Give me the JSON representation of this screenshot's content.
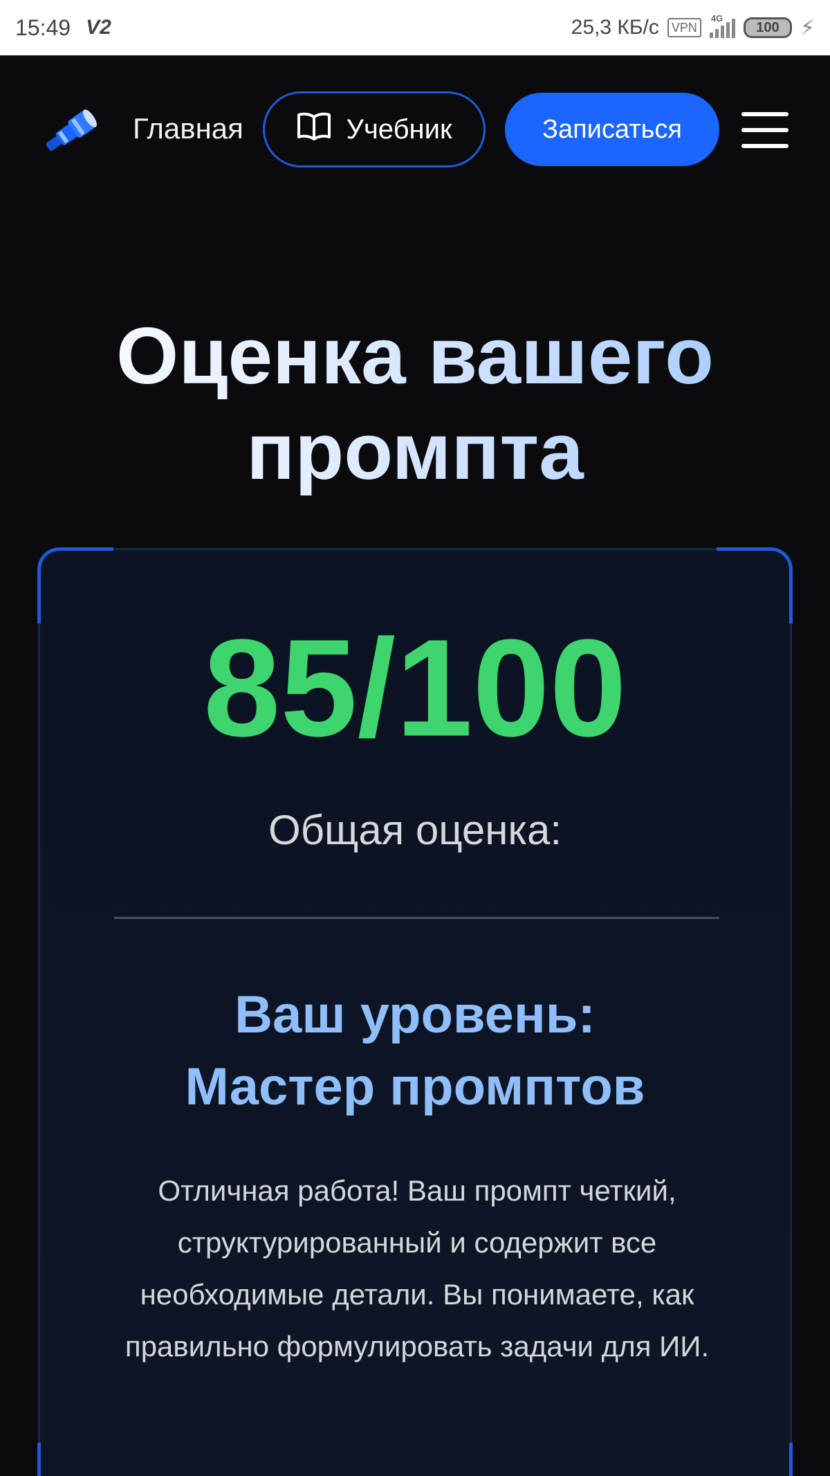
{
  "status_bar": {
    "time": "15:49",
    "carrier_icon": "V2",
    "speed": "25,3 КБ/с",
    "vpn": "VPN",
    "network": "4G",
    "battery": "100"
  },
  "header": {
    "home_label": "Главная",
    "tutorial_label": "Учебник",
    "signup_label": "Записаться",
    "icons": {
      "logo": "telescope-icon",
      "tutorial": "book-icon",
      "menu": "hamburger-menu-icon"
    }
  },
  "page": {
    "title_line1": "Оценка вашего",
    "title_line2": "промпта"
  },
  "result": {
    "score": "85/100",
    "score_value": 85,
    "score_max": 100,
    "score_label": "Общая оценка:",
    "level_line1": "Ваш уровень:",
    "level_line2": "Мастер промптов",
    "description": "Отличная работа! Ваш промпт четкий, структурированный и содержит все необходимые детали. Вы понимаете, как правильно формулировать задачи для ИИ."
  },
  "colors": {
    "accent": "#1a66ff",
    "score": "#3ed46e",
    "level": "#8fbefa",
    "background": "#0b0b0d"
  }
}
